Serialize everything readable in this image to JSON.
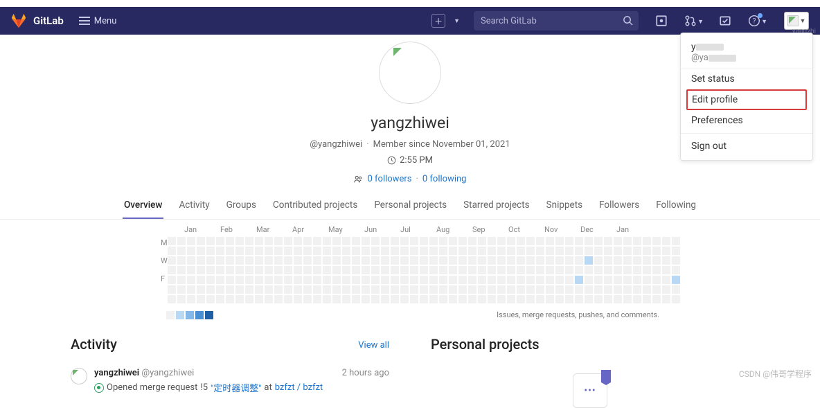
{
  "header": {
    "brand": "GitLab",
    "menu": "Menu",
    "search_placeholder": "Search GitLab",
    "avatar_label": "yangzhi"
  },
  "dropdown": {
    "name_prefix": "y",
    "handle_prefix": "@ya",
    "set_status": "Set status",
    "edit_profile": "Edit profile",
    "preferences": "Preferences",
    "sign_out": "Sign out"
  },
  "profile": {
    "name": "yangzhiwei",
    "handle": "@yangzhiwei",
    "member_since": "Member since November 01, 2021",
    "time": "2:55 PM",
    "followers": "0 followers",
    "following": "0 following"
  },
  "tabs": [
    "Overview",
    "Activity",
    "Groups",
    "Contributed projects",
    "Personal projects",
    "Starred projects",
    "Snippets",
    "Followers",
    "Following"
  ],
  "calendar": {
    "months": [
      "Jan",
      "Feb",
      "Mar",
      "Apr",
      "May",
      "Jun",
      "Jul",
      "Aug",
      "Sep",
      "Oct",
      "Nov",
      "Dec",
      "Jan"
    ],
    "days": [
      "M",
      "W",
      "F"
    ],
    "legend_text": "Issues, merge requests, pushes, and comments.",
    "marks": [
      {
        "col": 43,
        "row": 2,
        "level": 1
      },
      {
        "col": 42,
        "row": 4,
        "level": 1
      },
      {
        "col": 52,
        "row": 4,
        "level": 1
      }
    ]
  },
  "activity": {
    "heading": "Activity",
    "view_all": "View all",
    "item": {
      "user": "yangzhiwei",
      "handle": "@yangzhiwei",
      "time": "2 hours ago",
      "action": "Opened merge request",
      "ref": "!5",
      "title": "\"定时器调整\"",
      "at": "at",
      "project": "bzfzt / bzfzt"
    }
  },
  "personal": {
    "heading": "Personal projects"
  },
  "watermark": "CSDN @伟哥学程序"
}
